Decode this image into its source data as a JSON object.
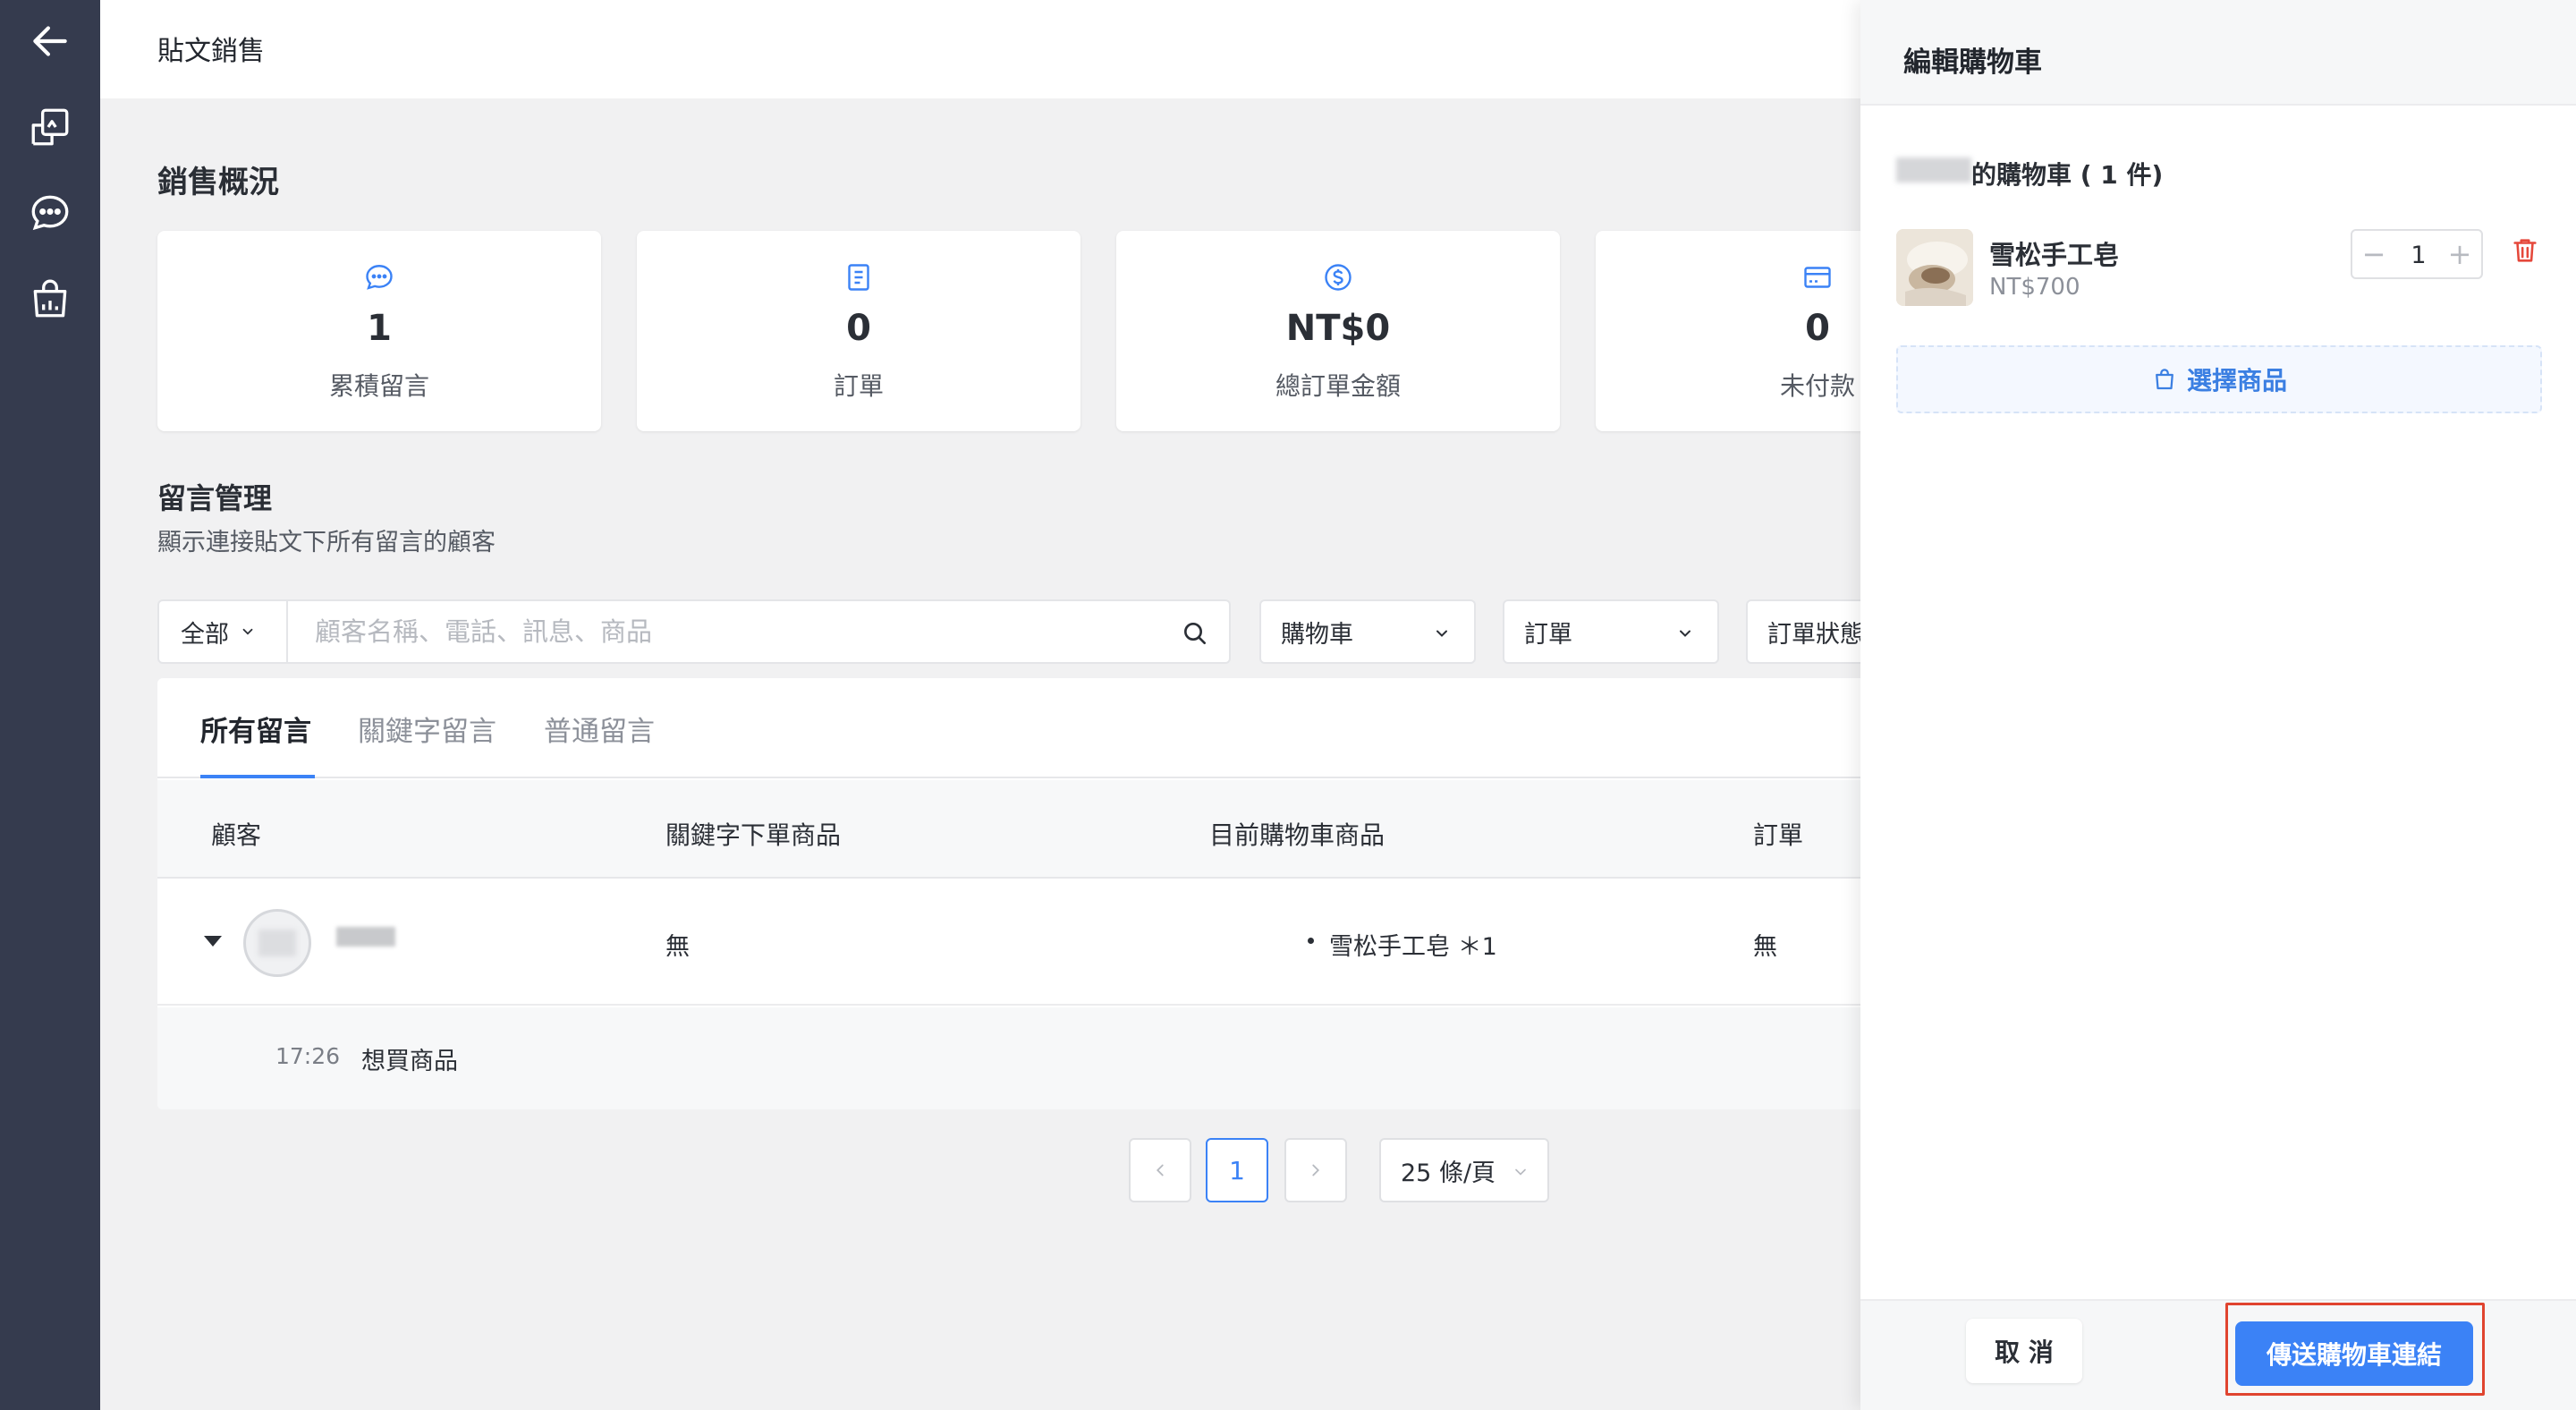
{
  "page": {
    "title": "貼文銷售"
  },
  "overview": {
    "title": "銷售概況",
    "cards": [
      {
        "icon": "chat-bubble-icon",
        "value": "1",
        "label": "累積留言"
      },
      {
        "icon": "clipboard-icon",
        "value": "0",
        "label": "訂單"
      },
      {
        "icon": "dollar-coin-icon",
        "value": "NT$0",
        "label": "總訂單金額"
      },
      {
        "icon": "credit-card-icon",
        "value": "0",
        "label": "未付款"
      }
    ]
  },
  "comments": {
    "title": "留言管理",
    "subtitle": "顯示連接貼文下所有留言的顧客",
    "filter_all": "全部",
    "search_placeholder": "顧客名稱、電話、訊息、商品",
    "dropdowns": [
      "購物車",
      "訂單",
      "訂單狀態"
    ],
    "tabs": [
      "所有留言",
      "關鍵字留言",
      "普通留言"
    ],
    "columns": [
      "顧客",
      "關鍵字下單商品",
      "目前購物車商品",
      "訂單"
    ],
    "rows": [
      {
        "keyword_item": "無",
        "cart_item": "雪松手工皂 ＊1",
        "order": "無",
        "comment_time": "17:26",
        "comment_text": "想買商品"
      }
    ]
  },
  "pagination": {
    "current": "1",
    "page_size": "25 條/頁"
  },
  "drawer": {
    "title": "編輯購物車",
    "cart_title": "的購物車 ( 1 件)",
    "product": {
      "name": "雪松手工皂",
      "price": "NT$700",
      "qty": "1"
    },
    "choose_label": "選擇商品",
    "cancel_label": "取 消",
    "send_label": "傳送購物車連結"
  },
  "colors": {
    "accent": "#3b82f6",
    "rail": "#353b4e",
    "highlight": "#e0442f"
  }
}
